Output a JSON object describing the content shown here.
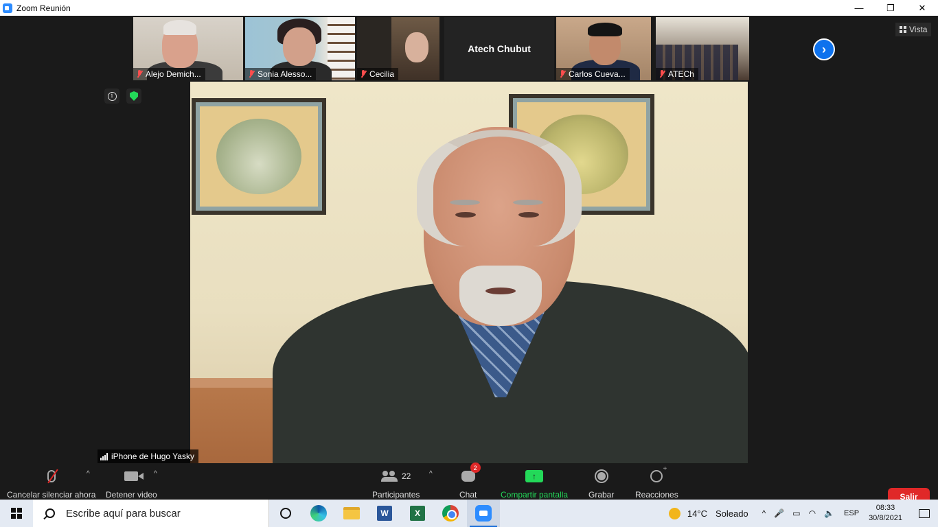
{
  "window": {
    "title": "Zoom Reunión",
    "minimize": "—",
    "restore": "❐",
    "close": "✕"
  },
  "strip": {
    "participants": [
      {
        "name": "Alejo Demich...",
        "muted": true
      },
      {
        "name": "Sonia Alesso...",
        "muted": true
      },
      {
        "name": "Cecilia",
        "muted": true
      },
      {
        "name": "Atech Chubut",
        "video": false
      },
      {
        "name": "Carlos Cueva...",
        "muted": true
      },
      {
        "name": "ATECh",
        "muted": true
      }
    ],
    "next_icon": "›",
    "view_label": "Vista"
  },
  "main": {
    "speaker_label": "iPhone de Hugo Yasky",
    "info_icon_glyph": "i"
  },
  "controls": {
    "mute": "Cancelar silenciar ahora",
    "video": "Detener video",
    "participants": "Participantes",
    "participants_count": "22",
    "chat": "Chat",
    "chat_badge": "2",
    "share": "Compartir pantalla",
    "share_glyph": "↑",
    "record": "Grabar",
    "reactions": "Reacciones",
    "leave": "Salir",
    "caret": "^",
    "accent_green": "#23d959",
    "leave_red": "#e02828"
  },
  "taskbar": {
    "search_placeholder": "Escribe aquí para buscar",
    "word_letter": "W",
    "excel_letter": "X",
    "weather_temp": "14°C",
    "weather_text": "Soleado",
    "language": "ESP",
    "time": "08:33",
    "date": "30/8/2021",
    "tray_up": "^",
    "tray_mic": "🎤",
    "tray_battery": "▭",
    "tray_wifi": "◠",
    "tray_volume": "🔈"
  }
}
